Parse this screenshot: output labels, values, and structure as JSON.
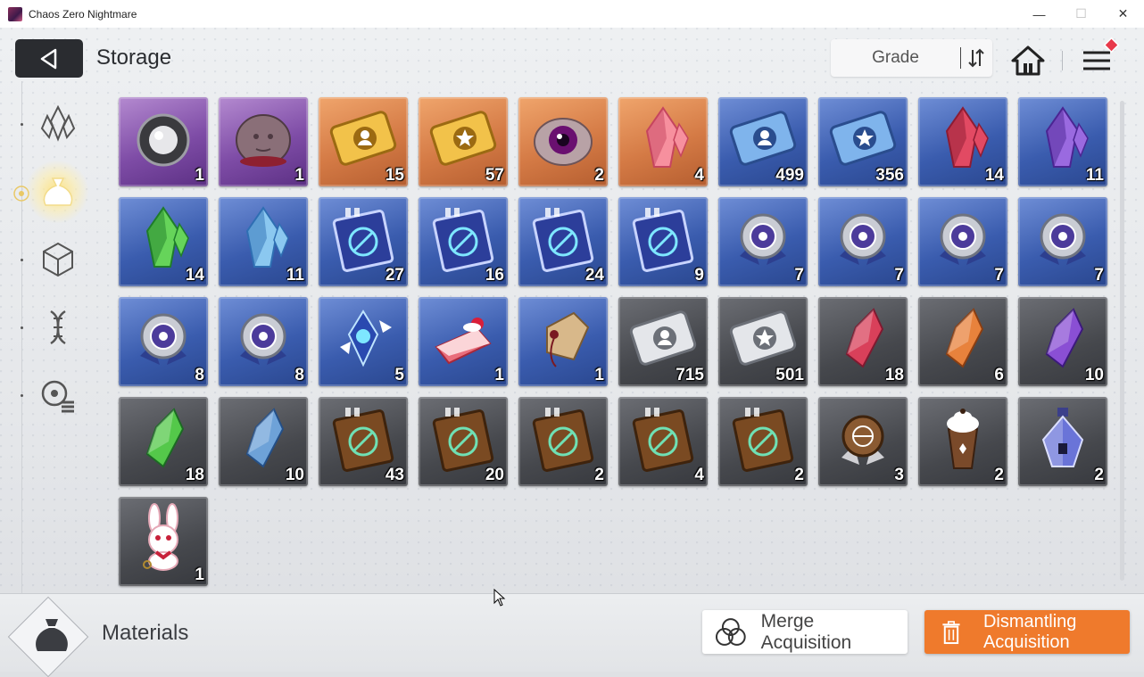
{
  "window": {
    "title": "Chaos Zero Nightmare"
  },
  "header": {
    "title": "Storage",
    "sort_label": "Grade"
  },
  "sidebar": {
    "items": [
      {
        "icon": "crystal-icon",
        "active": false
      },
      {
        "icon": "material-bag-icon",
        "active": true
      },
      {
        "icon": "cube-icon",
        "active": false
      },
      {
        "icon": "dna-icon",
        "active": false
      },
      {
        "icon": "list-icon",
        "active": false
      }
    ]
  },
  "items": [
    {
      "name": "pearl-orb-icon",
      "grade": "purple",
      "qty": "1"
    },
    {
      "name": "rock-face-icon",
      "grade": "purple",
      "qty": "1"
    },
    {
      "name": "gold-portrait-ticket-icon",
      "grade": "orange",
      "qty": "15"
    },
    {
      "name": "gold-star-ticket-icon",
      "grade": "orange",
      "qty": "57"
    },
    {
      "name": "eye-orb-icon",
      "grade": "orange",
      "qty": "2"
    },
    {
      "name": "pink-crystal-icon",
      "grade": "orange",
      "qty": "4"
    },
    {
      "name": "blue-portrait-ticket-icon",
      "grade": "blue",
      "qty": "499"
    },
    {
      "name": "blue-star-ticket-icon",
      "grade": "blue",
      "qty": "356"
    },
    {
      "name": "red-crystal-icon",
      "grade": "blue",
      "qty": "14"
    },
    {
      "name": "purple-crystal-icon",
      "grade": "blue",
      "qty": "11"
    },
    {
      "name": "green-crystal-icon",
      "grade": "blue",
      "qty": "14"
    },
    {
      "name": "cyan-crystal-icon",
      "grade": "blue",
      "qty": "11"
    },
    {
      "name": "sword-book-icon",
      "grade": "blue",
      "qty": "27"
    },
    {
      "name": "shield-book-icon",
      "grade": "blue",
      "qty": "16"
    },
    {
      "name": "wing-book-icon",
      "grade": "blue",
      "qty": "24"
    },
    {
      "name": "compass-book-icon",
      "grade": "blue",
      "qty": "9"
    },
    {
      "name": "medal-sword-icon",
      "grade": "blue",
      "qty": "7"
    },
    {
      "name": "medal-shield-icon",
      "grade": "blue",
      "qty": "7"
    },
    {
      "name": "medal-eye-icon",
      "grade": "blue",
      "qty": "7"
    },
    {
      "name": "medal-wing-icon",
      "grade": "blue",
      "qty": "7"
    },
    {
      "name": "medal-compass-icon",
      "grade": "blue",
      "qty": "8"
    },
    {
      "name": "medal-target-icon",
      "grade": "blue",
      "qty": "8"
    },
    {
      "name": "ice-shard-icon",
      "grade": "blue",
      "qty": "5"
    },
    {
      "name": "cake-slice-icon",
      "grade": "blue",
      "qty": "1"
    },
    {
      "name": "tag-charm-icon",
      "grade": "blue",
      "qty": "1"
    },
    {
      "name": "silver-portrait-ticket-icon",
      "grade": "gray",
      "qty": "715"
    },
    {
      "name": "silver-star-ticket-icon",
      "grade": "gray",
      "qty": "501"
    },
    {
      "name": "red-shard-icon",
      "grade": "gray",
      "qty": "18"
    },
    {
      "name": "orange-shard-icon",
      "grade": "gray",
      "qty": "6"
    },
    {
      "name": "purple-shard-icon",
      "grade": "gray",
      "qty": "10"
    },
    {
      "name": "green-shard-icon",
      "grade": "gray",
      "qty": "18"
    },
    {
      "name": "blue-shard-icon",
      "grade": "gray",
      "qty": "10"
    },
    {
      "name": "brown-sword-book-icon",
      "grade": "gray",
      "qty": "43"
    },
    {
      "name": "brown-shield-book-icon",
      "grade": "gray",
      "qty": "20"
    },
    {
      "name": "brown-eye-book-icon",
      "grade": "gray",
      "qty": "2"
    },
    {
      "name": "brown-wing-book-icon",
      "grade": "gray",
      "qty": "4"
    },
    {
      "name": "brown-compass-book-icon",
      "grade": "gray",
      "qty": "2"
    },
    {
      "name": "bronze-medal-icon",
      "grade": "gray",
      "qty": "3"
    },
    {
      "name": "frappe-cup-icon",
      "grade": "gray",
      "qty": "2"
    },
    {
      "name": "perfume-bottle-icon",
      "grade": "gray",
      "qty": "2"
    },
    {
      "name": "bunny-plush-icon",
      "grade": "gray",
      "qty": "1"
    }
  ],
  "footer": {
    "category_label": "Materials",
    "merge_label": "Merge Acquisition",
    "dismantle_label": "Dismantling Acquisition"
  },
  "colors": {
    "accent": "#ef7a2c",
    "purple": "#7e4ca6",
    "orange": "#d47a45",
    "blue": "#3a5cae",
    "gray": "#46484d"
  }
}
